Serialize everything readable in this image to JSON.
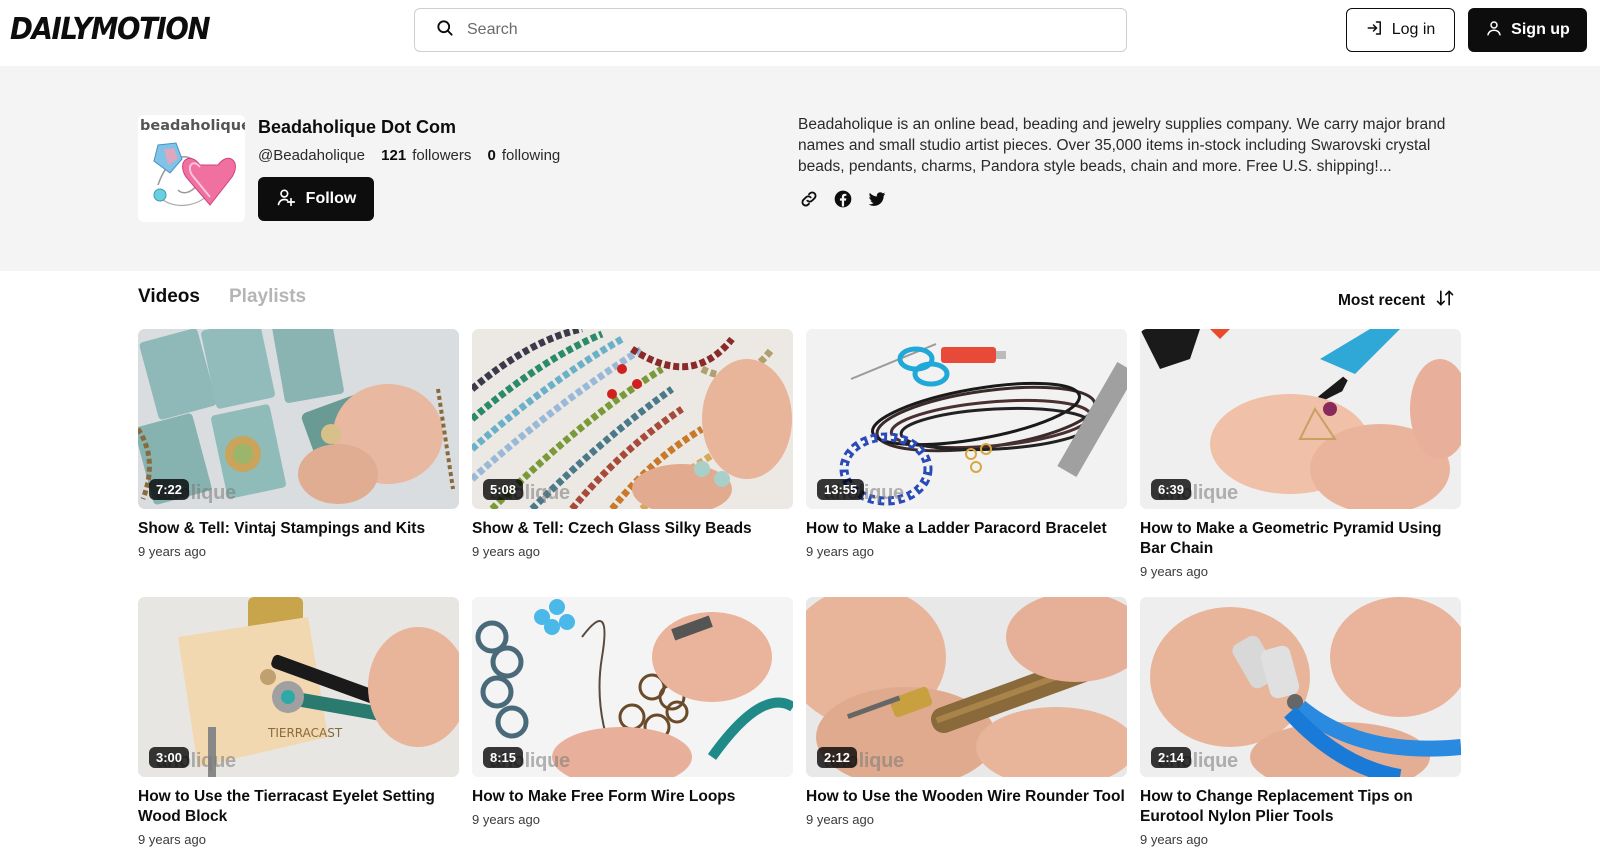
{
  "header": {
    "logo": "DAILYMOTION",
    "search_placeholder": "Search",
    "login_label": "Log in",
    "signup_label": "Sign up"
  },
  "channel": {
    "avatar_text": "beadaholique",
    "name": "Beadaholique Dot Com",
    "handle": "@Beadaholique",
    "followers_count": "121",
    "followers_label": "followers",
    "following_count": "0",
    "following_label": "following",
    "follow_label": "Follow",
    "bio": "Beadaholique is an online bead, beading and jewelry supplies company. We carry major brand names and small studio artist pieces. Over 35,000 items in-stock including Swarovski crystal beads, pendants, charms, Pandora style beads, chain and more. Free U.S. shipping!...",
    "socials": [
      "link-icon",
      "facebook-icon",
      "twitter-icon"
    ]
  },
  "tabs": {
    "videos": "Videos",
    "playlists": "Playlists",
    "sort_label": "Most recent"
  },
  "watermark": "aholique",
  "videos": [
    {
      "title": "Show & Tell: Vintaj Stampings and Kits",
      "age": "9 years ago",
      "duration": "7:22"
    },
    {
      "title": "Show & Tell: Czech Glass Silky Beads",
      "age": "9 years ago",
      "duration": "5:08"
    },
    {
      "title": "How to Make a Ladder Paracord Bracelet",
      "age": "9 years ago",
      "duration": "13:55"
    },
    {
      "title": "How to Make a Geometric Pyramid Using Bar Chain",
      "age": "9 years ago",
      "duration": "6:39"
    },
    {
      "title": "How to Use the Tierracast Eyelet Setting Wood Block",
      "age": "9 years ago",
      "duration": "3:00"
    },
    {
      "title": "How to Make Free Form Wire Loops",
      "age": "9 years ago",
      "duration": "8:15"
    },
    {
      "title": "How to Use the Wooden Wire Rounder Tool",
      "age": "9 years ago",
      "duration": "2:12"
    },
    {
      "title": "How to Change Replacement Tips on Eurotool Nylon Plier Tools",
      "age": "9 years ago",
      "duration": "2:14"
    }
  ]
}
